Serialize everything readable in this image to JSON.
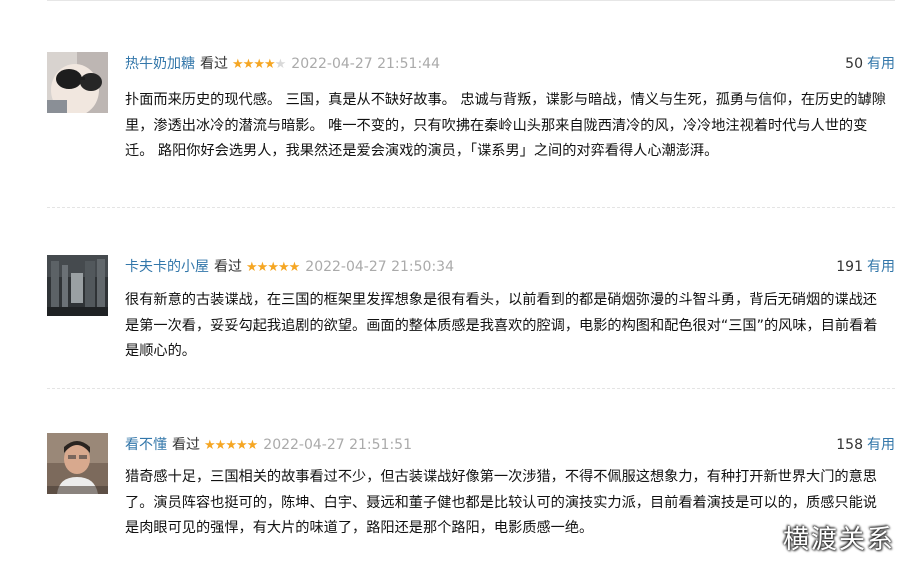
{
  "vote_label": "有用",
  "comments": [
    {
      "author": "热牛奶加糖",
      "status": "看过",
      "rating": 4,
      "max_rating": 5,
      "time": "2022-04-27 21:51:44",
      "votes": "50",
      "text": "扑面而来历史的现代感。 三国，真是从不缺好故事。 忠诚与背叛，谍影与暗战，情义与生死，孤勇与信仰，在历史的罅隙里，渗透出冰冷的潜流与暗影。 唯一不变的，只有吹拂在秦岭山头那来自陇西清冷的风，冷冷地注视着时代与人世的变迁。 路阳你好会选男人，我果然还是爱会演戏的演员，「谍系男」之间的对弈看得人心潮澎湃。"
    },
    {
      "author": "卡夫卡的小屋",
      "status": "看过",
      "rating": 5,
      "max_rating": 5,
      "time": "2022-04-27 21:50:34",
      "votes": "191",
      "text": "很有新意的古装谍战，在三国的框架里发挥想象是很有看头，以前看到的都是硝烟弥漫的斗智斗勇，背后无硝烟的谍战还是第一次看，妥妥勾起我追剧的欲望。画面的整体质感是我喜欢的腔调，电影的构图和配色很对“三国”的风味，目前看着是顺心的。"
    },
    {
      "author": "看不懂",
      "status": "看过",
      "rating": 5,
      "max_rating": 5,
      "time": "2022-04-27 21:51:51",
      "votes": "158",
      "text": "猎奇感十足，三国相关的故事看过不少，但古装谍战好像第一次涉猎，不得不佩服这想象力，有种打开新世界大门的意思了。演员阵容也挺可的，陈坤、白宇、聂远和董子健也都是比较认可的演技实力派，目前看着演技是可以的，质感只能说是肉眼可见的强悍，有大片的味道了，路阳还是那个路阳，电影质感一绝。"
    }
  ],
  "watermark": "横渡关系"
}
